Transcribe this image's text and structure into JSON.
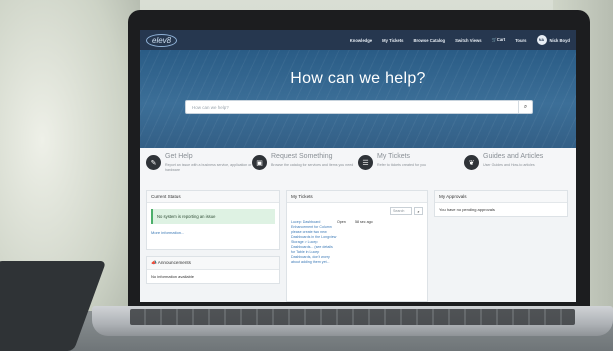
{
  "app": {
    "logo_text": "elev8"
  },
  "nav": {
    "items": [
      "Knowledge",
      "My Tickets",
      "Browse Catalog",
      "Switch Views",
      "Cart",
      "Tours"
    ],
    "avatar_initials": "NA",
    "user_name": "Nick Boyd"
  },
  "hero": {
    "title": "How can we help?",
    "search_placeholder": "How can we help?"
  },
  "quick_links": [
    {
      "title": "Get Help",
      "desc": "Report an issue with a business service, application or hardware",
      "icon": "clipboard-icon"
    },
    {
      "title": "Request Something",
      "desc": "Browse the catalog for services and items you need",
      "icon": "briefcase-icon"
    },
    {
      "title": "My Tickets",
      "desc": "Refer to tickets created for you",
      "icon": "list-icon"
    },
    {
      "title": "Guides and Articles",
      "desc": "User Guides and How-to articles",
      "icon": "book-icon"
    }
  ],
  "current_status": {
    "header": "Current Status",
    "message": "No system is reporting an issue",
    "more_info": "More information..."
  },
  "announcements": {
    "header": "Announcements",
    "message": "No information available"
  },
  "my_tickets": {
    "header": "My Tickets",
    "search_placeholder": "Search",
    "rows": [
      {
        "desc": "Lucep: Dashboard Enhancement for Column please create two new Dashboards in the Longview Storage > Lucep Dashboards... (see details for Table in Lucep Dashboards, don't worry about adding them yet...",
        "state": "Open",
        "when": "58 sec ago"
      }
    ]
  },
  "my_approvals": {
    "header": "My Approvals",
    "message": "You have no pending approvals"
  }
}
